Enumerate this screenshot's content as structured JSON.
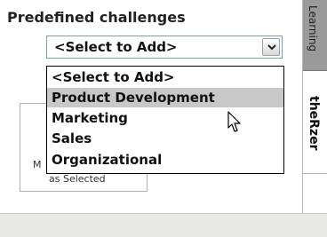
{
  "section": {
    "heading": "Predefined challenges"
  },
  "combo": {
    "selected": "<Select to Add>"
  },
  "dropdown": {
    "options": [
      "<Select to Add>",
      "Product Development",
      "Marketing",
      "Sales",
      "Organizational"
    ],
    "highlighted": "Product Development"
  },
  "behind": {
    "line1": "M",
    "line2": "as Selected"
  },
  "side_tabs": [
    "Learning",
    "theRzer"
  ],
  "colors": {
    "highlight": "#c8c8c8",
    "combo_border": "#7f9db9",
    "tab_inactive": "#9a9a9a"
  },
  "icons": {
    "combo_button": "chevron-down-icon",
    "pointer": "mouse-cursor-icon"
  }
}
